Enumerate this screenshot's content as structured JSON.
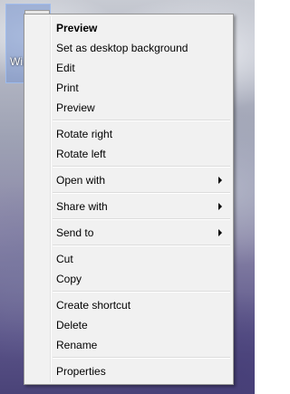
{
  "desktop": {
    "icon_label": "Wi... P..."
  },
  "menu": {
    "items": [
      {
        "label": "Preview",
        "bold": true
      },
      {
        "label": "Set as desktop background"
      },
      {
        "label": "Edit"
      },
      {
        "label": "Print"
      },
      {
        "label": "Preview"
      },
      {
        "label": "Rotate right"
      },
      {
        "label": "Rotate left"
      },
      {
        "label": "Open with",
        "submenu": true
      },
      {
        "label": "Share with",
        "submenu": true
      },
      {
        "label": "Send to",
        "submenu": true
      },
      {
        "label": "Cut"
      },
      {
        "label": "Copy"
      },
      {
        "label": "Create shortcut"
      },
      {
        "label": "Delete"
      },
      {
        "label": "Rename"
      },
      {
        "label": "Properties"
      }
    ]
  }
}
